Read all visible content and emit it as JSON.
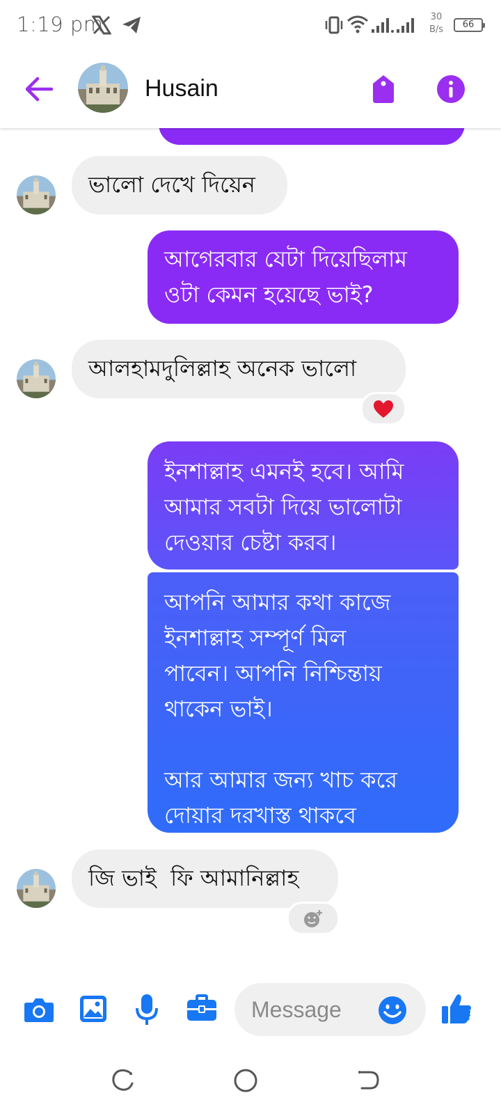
{
  "status_bar": {
    "time": "1:19 pm",
    "net_speed_value": "30",
    "net_speed_unit": "B/s",
    "battery": "66"
  },
  "header": {
    "contact_name": "Husain",
    "accent_color": "#9b2fef"
  },
  "messages": [
    {
      "direction": "in",
      "text": "ভালো দেখে দিয়েন"
    },
    {
      "direction": "out",
      "text": "আগেরবার যেটা দিয়েছিলাম\nওটা কেমন হয়েছে ভাই?"
    },
    {
      "direction": "in",
      "text": "আলহামদুলিল্লাহ অনেক ভালো",
      "reaction": "heart"
    },
    {
      "direction": "out",
      "text": "ইনশাল্লাহ এমনই হবে। আমি\nআমার সবটা দিয়ে ভালোটা\nদেওয়ার চেষ্টা করব।"
    },
    {
      "direction": "out",
      "text": "আপনি আমার কথা কাজে\nইনশাল্লাহ সম্পূর্ণ মিল\nপাবেন। আপনি নিশ্চিন্তায়\nথাকেন ভাই।\n\nআর আমার জন্য খাচ করে\nদোয়ার দরখাস্ত থাকবে"
    },
    {
      "direction": "in",
      "text": "জি ভাই  ফি আমানিল্লাহ",
      "reaction": "add-reaction"
    }
  ],
  "composer": {
    "placeholder": "Message"
  },
  "colors": {
    "purple": "#8a2bf5",
    "violet": "#6a4cf7",
    "blue": "#2f6cf9",
    "incoming_bg": "#efefef",
    "icon_blue": "#1877f2"
  }
}
